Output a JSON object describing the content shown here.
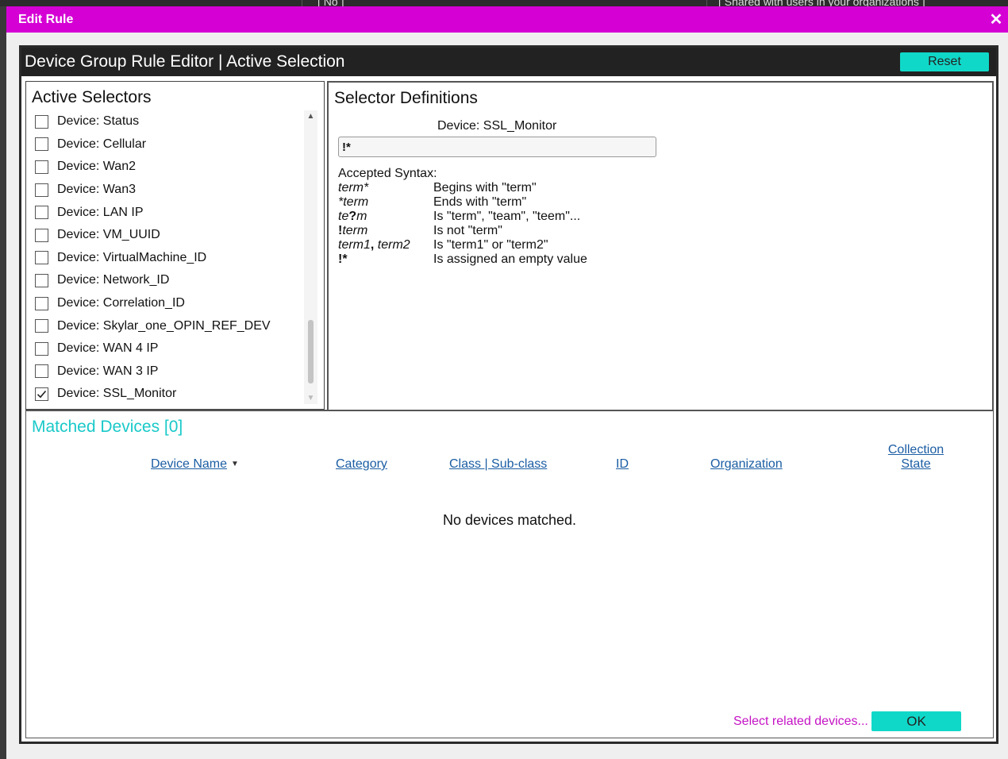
{
  "background": {
    "fragments": [
      "[ No ]",
      "[ Shared with users in your organizations ]"
    ]
  },
  "dialog": {
    "title": "Edit Rule",
    "close_icon": "✕"
  },
  "editor": {
    "title": "Device Group Rule Editor | Active Selection",
    "reset_label": "Reset"
  },
  "active_selectors": {
    "heading": "Active Selectors",
    "items": [
      {
        "label": "Device: Status",
        "checked": false
      },
      {
        "label": "Device: Cellular",
        "checked": false
      },
      {
        "label": "Device: Wan2",
        "checked": false
      },
      {
        "label": "Device: Wan3",
        "checked": false
      },
      {
        "label": "Device: LAN IP",
        "checked": false
      },
      {
        "label": "Device: VM_UUID",
        "checked": false
      },
      {
        "label": "Device: VirtualMachine_ID",
        "checked": false
      },
      {
        "label": "Device: Network_ID",
        "checked": false
      },
      {
        "label": "Device: Correlation_ID",
        "checked": false
      },
      {
        "label": "Device: Skylar_one_OPIN_REF_DEV",
        "checked": false
      },
      {
        "label": "Device: WAN 4 IP",
        "checked": false
      },
      {
        "label": "Device: WAN 3 IP",
        "checked": false
      },
      {
        "label": "Device: SSL_Monitor",
        "checked": true
      }
    ]
  },
  "selector_definitions": {
    "heading": "Selector Definitions",
    "field_label": "Device: SSL_Monitor",
    "field_value": "!*",
    "syntax_heading": "Accepted Syntax:",
    "syntax": [
      {
        "term_html": "term*",
        "desc": "Begins with \"term\""
      },
      {
        "term_html": "*term",
        "desc": "Ends with \"term\""
      },
      {
        "term_html": "te<b>?</b>m",
        "desc": "Is \"term\", \"team\", \"teem\"..."
      },
      {
        "term_html": "<b>!</b>term",
        "desc": "Is not \"term\""
      },
      {
        "term_html": "term1<b>,</b> term2",
        "desc": "Is \"term1\" or \"term2\""
      },
      {
        "term_html": "<b>!*</b>",
        "desc": "Is assigned an empty value"
      }
    ]
  },
  "matched": {
    "heading": "Matched Devices [0]",
    "columns": {
      "device_name": "Device Name",
      "category": "Category",
      "class": "Class | Sub-class",
      "id": "ID",
      "organization": "Organization",
      "collection_state_1": "Collection",
      "collection_state_2": "State"
    },
    "sort_icon": "▼",
    "empty_message": "No devices matched.",
    "related_link": "Select related devices...",
    "ok_label": "OK"
  }
}
